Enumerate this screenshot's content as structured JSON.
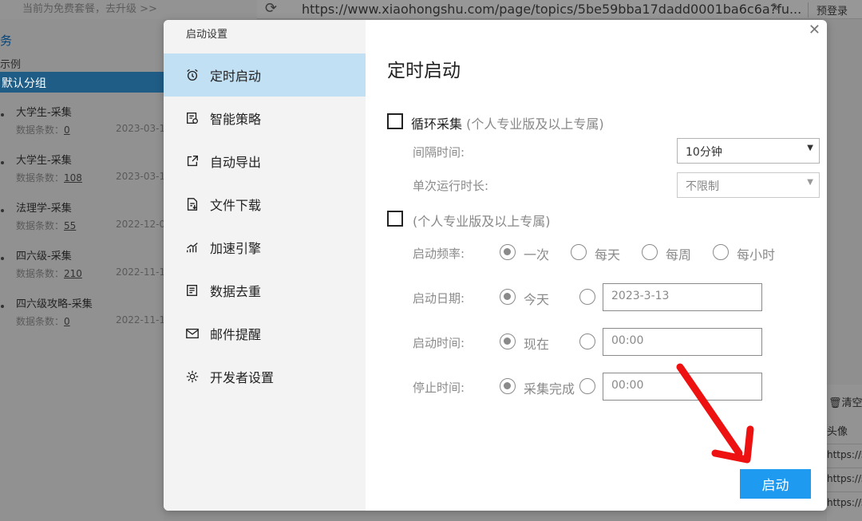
{
  "background": {
    "plan_text": "当前为免费套餐，去升级 >>",
    "url": "https://www.xiaohongshu.com/page/topics/5be59bba17dadd0001ba6c6a?fu...",
    "login_label": "预登录",
    "section_title": "务",
    "example_label": "示例",
    "group_label": "默认分组",
    "tasks": [
      {
        "name": "大学生-采集",
        "count_label": "数据条数：",
        "count": "0",
        "date": "2023-03-1"
      },
      {
        "name": "大学生-采集",
        "count_label": "数据条数：",
        "count": "108",
        "date": "2023-03-1"
      },
      {
        "name": "法理学-采集",
        "count_label": "数据条数：",
        "count": "55",
        "date": "2022-12-0"
      },
      {
        "name": "四六级-采集",
        "count_label": "数据条数：",
        "count": "210",
        "date": "2022-11-1"
      },
      {
        "name": "四六级攻略-采集",
        "count_label": "数据条数：",
        "count": "0",
        "date": "2022-11-1"
      }
    ],
    "right_panel": {
      "clear_label": "清空",
      "column_header": "头像",
      "cells": [
        "https://sn",
        "https://sn",
        "https://sn"
      ]
    }
  },
  "dialog": {
    "sidebar_title": "启动设置",
    "nav": [
      {
        "label": "定时启动",
        "icon": "alarm-clock-icon",
        "active": true
      },
      {
        "label": "智能策略",
        "icon": "strategy-doc-icon",
        "active": false
      },
      {
        "label": "自动导出",
        "icon": "export-icon",
        "active": false
      },
      {
        "label": "文件下载",
        "icon": "file-download-icon",
        "active": false
      },
      {
        "label": "加速引擎",
        "icon": "speed-chart-icon",
        "active": false
      },
      {
        "label": "数据去重",
        "icon": "dedup-list-icon",
        "active": false
      },
      {
        "label": "邮件提醒",
        "icon": "mail-icon",
        "active": false
      },
      {
        "label": "开发者设置",
        "icon": "gear-icon",
        "active": false
      }
    ],
    "title": "定时启动",
    "loop_collect": {
      "label": "循环采集",
      "note": "(个人专业版及以上专属)",
      "interval_label": "间隔时间:",
      "interval_value": "10分钟",
      "single_run_label": "单次运行时长:",
      "single_run_value": "不限制"
    },
    "schedule": {
      "note": "(个人专业版及以上专属)",
      "frequency_label": "启动频率:",
      "frequency_options": [
        "一次",
        "每天",
        "每周",
        "每小时"
      ],
      "frequency_selected": "一次",
      "date_label": "启动日期:",
      "date_option": "今天",
      "date_value": "2023-3-13",
      "time_label": "启动时间:",
      "time_option": "现在",
      "time_value": "00:00",
      "stop_label": "停止时间:",
      "stop_option": "采集完成",
      "stop_value": "00:00"
    },
    "start_button": "启动",
    "accent_color": "#1e9bf0",
    "active_nav_color": "#c2e0f4",
    "annotation_arrow_color": "#ee1111"
  }
}
